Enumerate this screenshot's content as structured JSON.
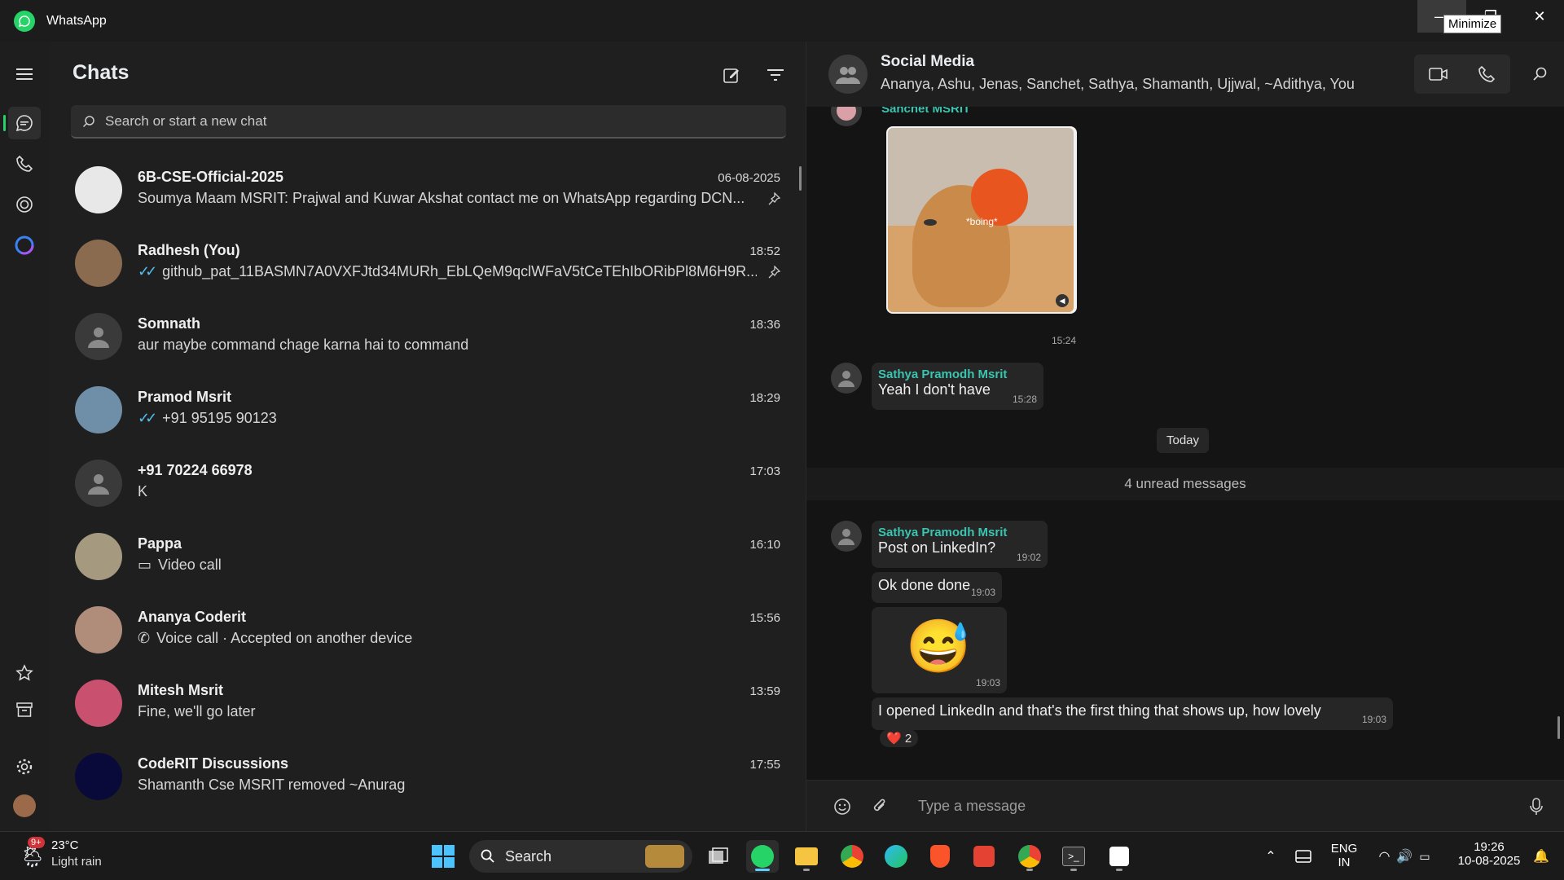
{
  "app": {
    "title": "WhatsApp"
  },
  "window": {
    "tooltip": "Minimize"
  },
  "chatlist": {
    "title": "Chats",
    "search_placeholder": "Search or start a new chat",
    "chats": [
      {
        "name": "6B-CSE-Official-2025",
        "time": "06-08-2025",
        "preview": "Soumya Maam MSRIT: Prajwal and Kuwar Akshat contact me on WhatsApp regarding DCN...",
        "pinned": true,
        "avatar_color": "#e8e8e8"
      },
      {
        "name": "Radhesh (You)",
        "time": "18:52",
        "preview": "github_pat_11BASMN7A0VXFJtd34MURh_EbLQeM9qclWFaV5tCeTEhIbORibPl8M6H9R...",
        "ticks": true,
        "pinned": true,
        "avatar_color": "#8a6b4f"
      },
      {
        "name": "Somnath",
        "time": "18:36",
        "preview": "aur maybe command chage karna hai to command",
        "avatar_color": "default"
      },
      {
        "name": "Pramod Msrit",
        "time": "18:29",
        "preview": "+91 95195 90123",
        "ticks": true,
        "avatar_color": "#6f8fa8"
      },
      {
        "name": "+91 70224 66978",
        "time": "17:03",
        "preview": "K",
        "avatar_color": "default"
      },
      {
        "name": "Pappa",
        "time": "16:10",
        "preview": "Video call",
        "icon": "video-icon",
        "avatar_color": "#a59a80"
      },
      {
        "name": "Ananya Coderit",
        "time": "15:56",
        "preview": "Voice call · Accepted on another device",
        "icon": "phone-icon",
        "avatar_color": "#b08d7a"
      },
      {
        "name": "Mitesh Msrit",
        "time": "13:59",
        "preview": "Fine, we'll go later",
        "avatar_color": "#c9516f"
      },
      {
        "name": "CodeRIT Discussions",
        "time": "17:55",
        "preview": "Shamanth Cse MSRIT removed ~Anurag",
        "avatar_color": "#0a0a3a"
      }
    ]
  },
  "conversation": {
    "group_name": "Social Media",
    "members": "Ananya, Ashu, Jenas, Sanchet, Sathya, Shamanth, Ujjwal, ~Adithya, You",
    "top_sender": "Sanchet MSRIT",
    "gif_caption": "*boing*",
    "gif_time": "15:24",
    "msg1": {
      "sender": "Sathya Pramodh Msrit",
      "text": "Yeah I don't have",
      "time": "15:28"
    },
    "date_chip": "Today",
    "unread": "4 unread messages",
    "msg2": {
      "sender": "Sathya Pramodh Msrit",
      "text": "Post on LinkedIn?",
      "time": "19:02"
    },
    "msg3": {
      "text": "Ok done done",
      "time": "19:03"
    },
    "msg4": {
      "emoji": "😅",
      "time": "19:03"
    },
    "msg5": {
      "text": "I opened LinkedIn and that's the first thing that shows up, how lovely",
      "time": "19:03",
      "reaction": "❤️",
      "reaction_count": "2"
    },
    "composer_placeholder": "Type a message"
  },
  "taskbar": {
    "weather_temp": "23°C",
    "weather_desc": "Light rain",
    "weather_badge": "9+",
    "search_label": "Search",
    "lang": "ENG",
    "region": "IN",
    "clock_time": "19:26",
    "clock_date": "10-08-2025"
  },
  "colors": {
    "accent": "#25d366",
    "sender": "#3bc4b0",
    "tick": "#53bdeb"
  }
}
